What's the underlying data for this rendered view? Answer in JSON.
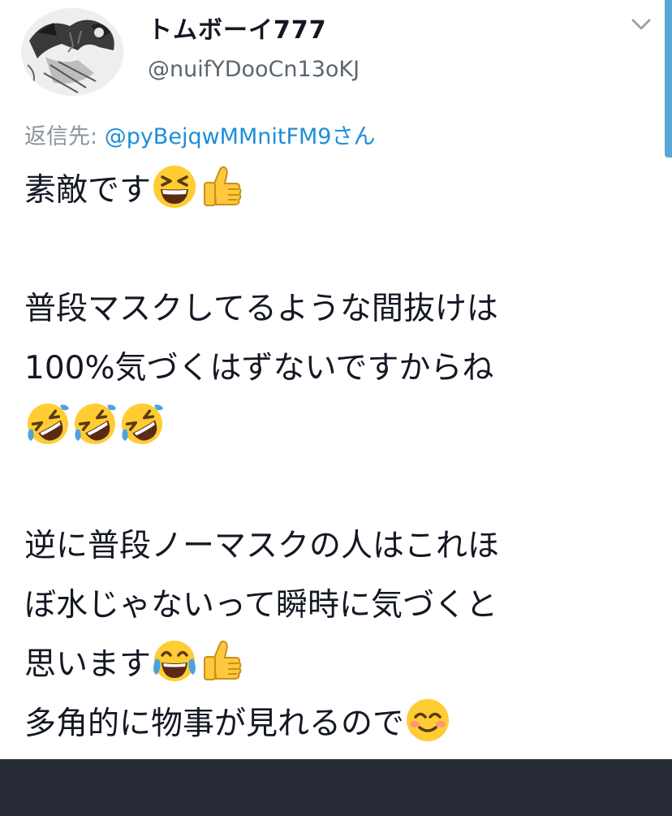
{
  "tweet": {
    "display_name": "トムボーイ777",
    "handle": "@nuifYDooCn13oKJ",
    "reply_prefix": "返信先: ",
    "reply_mention": "@pyBejqwMMnitFM9さん",
    "lines": {
      "l1": "素敵です",
      "l2": "普段マスクしてるような間抜けは",
      "l3": "100%気づくはずないですからね",
      "l4": "逆に普段ノーマスクの人はこれほ",
      "l5": "ぼ水じゃないって瞬時に気づくと",
      "l6": "思います",
      "l7": "多角的に物事が見れるので"
    }
  },
  "icons": {
    "avatar": "avatar-illustration",
    "menu": "chevron-down-icon",
    "emoji_1": "grinning-squinting-face",
    "emoji_2": "thumbs-up",
    "emoji_3": "rolling-on-floor-laughing",
    "emoji_4": "face-with-tears-of-joy",
    "emoji_5": "smiling-face-with-smiling-eyes"
  },
  "colors": {
    "mention": "#1d8ed6",
    "secondary_text": "#5b6670",
    "scroll_indicator": "#5aa7d6",
    "bottom_bar": "#282c36"
  }
}
